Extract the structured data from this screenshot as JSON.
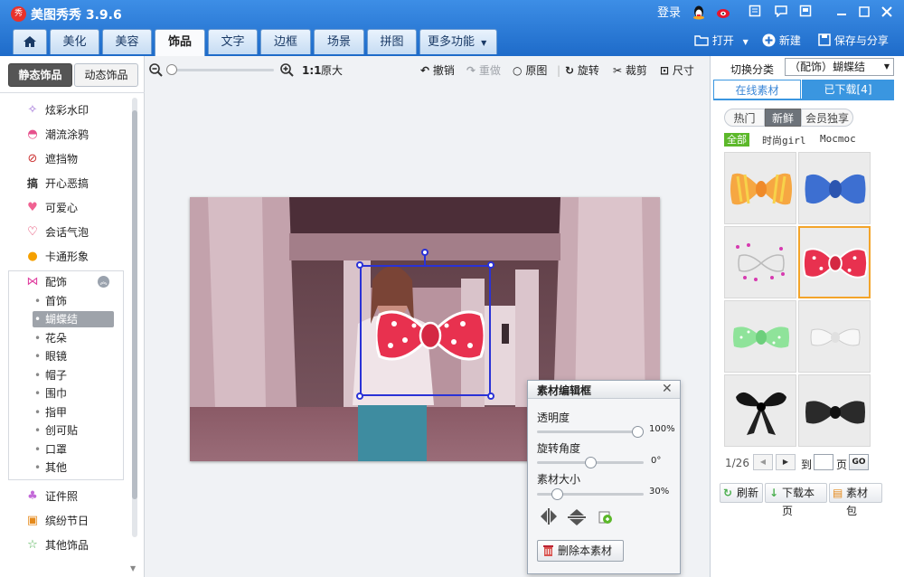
{
  "app": {
    "logo_glyph": "秀",
    "title": "美图秀秀 3.9.6",
    "login": "登录"
  },
  "nav": {
    "home_icon": "home-icon",
    "tabs": [
      "美化",
      "美容",
      "饰品",
      "文字",
      "边框",
      "场景",
      "拼图",
      "更多功能"
    ],
    "active_tab": "饰品"
  },
  "file_actions": {
    "open": "打开",
    "new": "新建",
    "save_share": "保存与分享"
  },
  "left_panel": {
    "tabs": [
      "静态饰品",
      "动态饰品"
    ],
    "categories_top": [
      "炫彩水印",
      "潮流涂鸦",
      "遮挡物",
      "开心恶搞",
      "可爱心",
      "会话气泡",
      "卡通形象"
    ],
    "expanded_category": "配饰",
    "sub_items": [
      "首饰",
      "蝴蝶结",
      "花朵",
      "眼镜",
      "帽子",
      "围巾",
      "指甲",
      "创可贴",
      "口罩",
      "其他"
    ],
    "selected_sub": "蝴蝶结",
    "categories_bottom": [
      "证件照",
      "缤纷节日",
      "其他饰品"
    ]
  },
  "toolbar": {
    "one_to_one": "1:1",
    "original_size": "原大",
    "undo": "撤销",
    "redo": "重做",
    "original": "原图",
    "rotate": "旋转",
    "crop": "裁剪",
    "size": "尺寸"
  },
  "right_panel": {
    "switch_label": "切换分类",
    "category_value": "（配饰）蝴蝶结",
    "tabs": {
      "online": "在线素材",
      "downloaded": "已下载[4]"
    },
    "filters": [
      "热门",
      "新鲜",
      "会员独享"
    ],
    "active_filter": "新鲜",
    "source_filters": [
      "全部",
      "时尚girl",
      "Mocmoc"
    ],
    "pagination": {
      "page": "1/26",
      "goto_label": "到",
      "page_suffix": "页",
      "go": "GO"
    },
    "buttons": {
      "refresh": "刷新",
      "download_page": "下载本页",
      "pack": "素材包"
    }
  },
  "editor": {
    "title": "素材编辑框",
    "opacity": {
      "label": "透明度",
      "value": "100%",
      "level": 1.0
    },
    "rotation": {
      "label": "旋转角度",
      "value": "0°",
      "level": 0.5
    },
    "size": {
      "label": "素材大小",
      "value": "30%",
      "level": 0.15
    },
    "delete_label": "删除本素材"
  },
  "colors": {
    "title_blue": "#2a7ad8",
    "accent_blue": "#3a96e0",
    "selection_orange": "#f3a42a",
    "green_tag": "#5cb82a",
    "bow_red": "#e8314f"
  }
}
